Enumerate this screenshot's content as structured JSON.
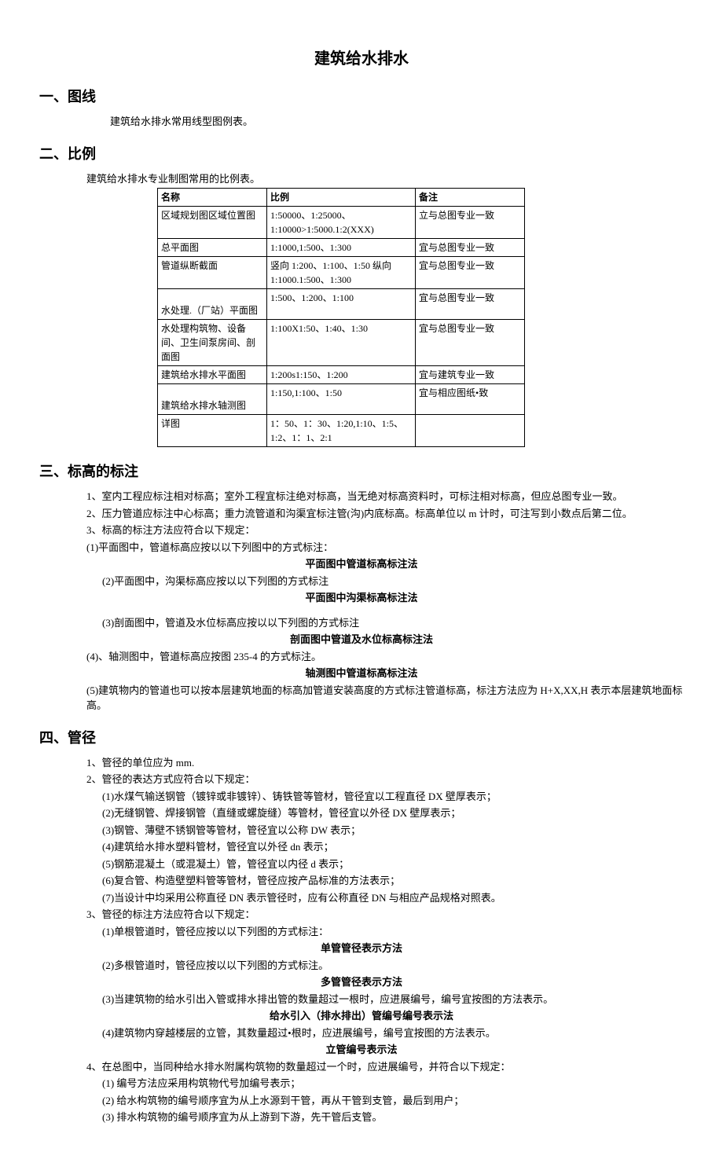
{
  "title": "建筑给水排水",
  "s1": {
    "heading": "一、图线",
    "line1": "建筑给水排水常用线型图例表。"
  },
  "s2": {
    "heading": "二、比例",
    "intro": "建筑给水排水专业制图常用的比例表。",
    "th_name": "名称",
    "th_scale": "比例",
    "th_note": "备注",
    "rows": [
      {
        "name": "区域规划图区域位置图",
        "scale": "1:50000、1:25000、1:10000>1:5000.1:2(XXX)",
        "note": "立与总图专业一致"
      },
      {
        "name": "总平面图",
        "scale": "1:1000,1:500、1:300",
        "note": "宜与总图专业一致"
      },
      {
        "name": "管道纵断截面",
        "scale": "竖向 1:200、1:100、1:50 纵向 1:1000.1:500、1:300",
        "note": "宜与总图专业一致"
      },
      {
        "name": "水处理.（厂站）平面图",
        "scale": "1:500、1:200、1:100",
        "note": "宜与总图专业一致"
      },
      {
        "name": "水处理构筑物、设备间、卫生间泵房间、剖面图",
        "scale": "1:100X1:50、1:40、1:30",
        "note": "宜与总图专业一致"
      },
      {
        "name": "建筑给水排水平面图",
        "scale": "1:200s1:150、1:200",
        "note": "宜与建筑专业一致"
      },
      {
        "name": "建筑给水排水轴测图",
        "scale": "1:150,1:100、1:50",
        "note": "宜与相应图纸•致"
      },
      {
        "name": "详图",
        "scale": "1：50、1：30、1:20,1:10、1:5、1:2、1：1、2:1",
        "note": ""
      }
    ]
  },
  "s3": {
    "heading": "三、标高的标注",
    "p1": "1、室内工程应标注相对标高；室外工程宜标注绝对标高，当无绝对标高资料时，可标注相对标高，但应总图专业一致。",
    "p2": "2、压力管道应标注中心标高；重力流管道和沟渠宜标注管(沟)内底标高。标高单位以 m 计时，可注写到小数点后第二位。",
    "p3": "3、标高的标注方法应符合以下规定：",
    "p4": "(1)平面图中，管道标高应按以以下列图中的方式标注：",
    "c1": "平面图中管道标高标注法",
    "p5": "(2)平面图中，沟渠标高应按以以下列图的方式标注",
    "c2": "平面图中沟渠标高标注法",
    "p6": "(3)剖面图中，管道及水位标高应按以以下列图的方式标注",
    "c3": "剖面图中管道及水位标高标注法",
    "p7": "(4)、轴测图中，管道标高应按图 235-4 的方式标注。",
    "c4": "轴测图中管道标高标注法",
    "p8": "(5)建筑物内的管道也可以按本层建筑地面的标高加管道安装高度的方式标注管道标高，标注方法应为 H+X,XX,H 表示本层建筑地面标高。"
  },
  "s4": {
    "heading": "四、管径",
    "p1": "1、管径的单位应为 mm.",
    "p2": "2、管径的表达方式应符合以下规定：",
    "p3": "(1)水煤气输送钢管（镀锌或非镀锌）、铸铁管等管材，管径宜以工程直径 DX 壁厚表示；",
    "p4": "(2)无缝钢管、焊接钢管（直缝或螺旋缝）等管材，管径宜以外径 DX 壁厚表示；",
    "p5": "(3)钢管、薄壁不锈钢管等管材，管径宜以公称 DW 表示；",
    "p6": "(4)建筑给水排水塑料管材，管径宜以外径 dn 表示；",
    "p7": "(5)钢筋混凝土（或混凝土）管，管径宜以内径 d 表示；",
    "p8": "(6)复合管、构造壁塑料管等管材，管径应按产品标准的方法表示；",
    "p9": "(7)当设计中均采用公称直径 DN 表示管径时，应有公称直径 DN 与相应产品规格对照表。",
    "p10": "3、管径的标注方法应符合以下规定：",
    "p11": "(1)单根管道时，管径应按以以下列图的方式标注：",
    "c1": "单管管径表示方法",
    "p12": "(2)多根管道时，管径应按以以下列图的方式标注。",
    "c2": "多管管径表示方法",
    "p13": "(3)当建筑物的给水引出入管或排水排出管的数量超过一根时，应进展编号，编号宜按图的方法表示。",
    "c3": "给水引入（排水排出）管编号编号表示法",
    "p14": "(4)建筑物内穿越楼层的立管，其数量超过•根时，应进展编号，编号宜按图的方法表示。",
    "c4": "立管编号表示法",
    "p15": "4、在总图中，当同种给水排水附属构筑物的数量超过一个时，应进展编号，并符合以下规定：",
    "p16": "(1)      编号方法应采用构筑物代号加编号表示；",
    "p17": "(2)      给水构筑物的编号顺序宜为从上水源到干管，再从干管到支管，最后到用户；",
    "p18": "(3)      排水构筑物的编号顺序宜为从上游到下游，先干管后支管。"
  }
}
